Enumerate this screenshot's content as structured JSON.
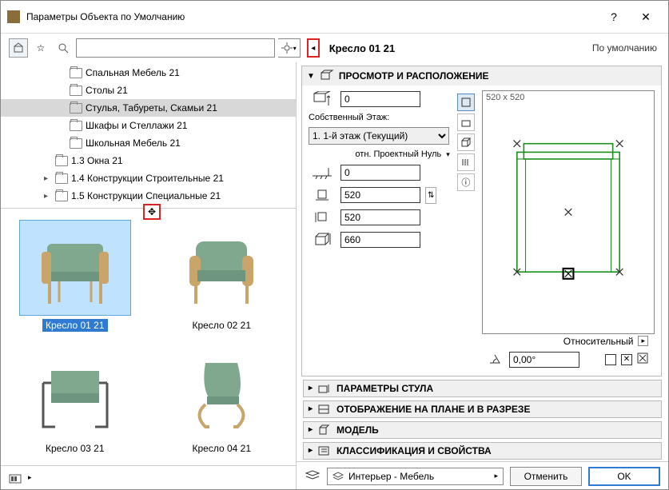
{
  "window": {
    "title": "Параметры Объекта по Умолчанию"
  },
  "header": {
    "object_name": "Кресло 01 21",
    "default_label": "По умолчанию"
  },
  "tree": {
    "items": [
      {
        "label": "Спальная Мебель 21",
        "indent": 60,
        "arrow": "",
        "sel": false
      },
      {
        "label": "Столы 21",
        "indent": 60,
        "arrow": "",
        "sel": false
      },
      {
        "label": "Стулья, Табуреты, Скамьи 21",
        "indent": 60,
        "arrow": "",
        "sel": true
      },
      {
        "label": "Шкафы и Стеллажи 21",
        "indent": 60,
        "arrow": "",
        "sel": false
      },
      {
        "label": "Школьная Мебель 21",
        "indent": 60,
        "arrow": "",
        "sel": false
      },
      {
        "label": "1.3 Окна 21",
        "indent": 42,
        "arrow": "",
        "sel": false
      },
      {
        "label": "1.4 Конструкции Строительные 21",
        "indent": 42,
        "arrow": "▸",
        "sel": false
      },
      {
        "label": "1.5 Конструкции Специальные 21",
        "indent": 42,
        "arrow": "▸",
        "sel": false
      }
    ]
  },
  "thumbs": [
    {
      "label": "Кресло 01 21",
      "sel": true
    },
    {
      "label": "Кресло 02 21",
      "sel": false
    },
    {
      "label": "Кресло 03 21",
      "sel": false
    },
    {
      "label": "Кресло 04 21",
      "sel": false
    }
  ],
  "preview_section": {
    "title": "ПРОСМОТР И РАСПОЛОЖЕНИЕ",
    "elev": "0",
    "floor_label": "Собственный Этаж:",
    "floor_value": "1. 1-й этаж (Текущий)",
    "rel_label": "отн. Проектный Нуль",
    "rel_z": "0",
    "dim_x": "520",
    "dim_y": "520",
    "dim_z": "660",
    "preview_dims": "520 x 520",
    "relative_label": "Относительный",
    "angle": "0,00°"
  },
  "sections": {
    "s1": "ПАРАМЕТРЫ СТУЛА",
    "s2": "ОТОБРАЖЕНИЕ НА ПЛАНЕ И В РАЗРЕЗЕ",
    "s3": "МОДЕЛЬ",
    "s4": "КЛАССИФИКАЦИЯ И СВОЙСТВА"
  },
  "bottom": {
    "layer": "Интерьер - Мебель",
    "cancel": "Отменить",
    "ok": "OK"
  }
}
